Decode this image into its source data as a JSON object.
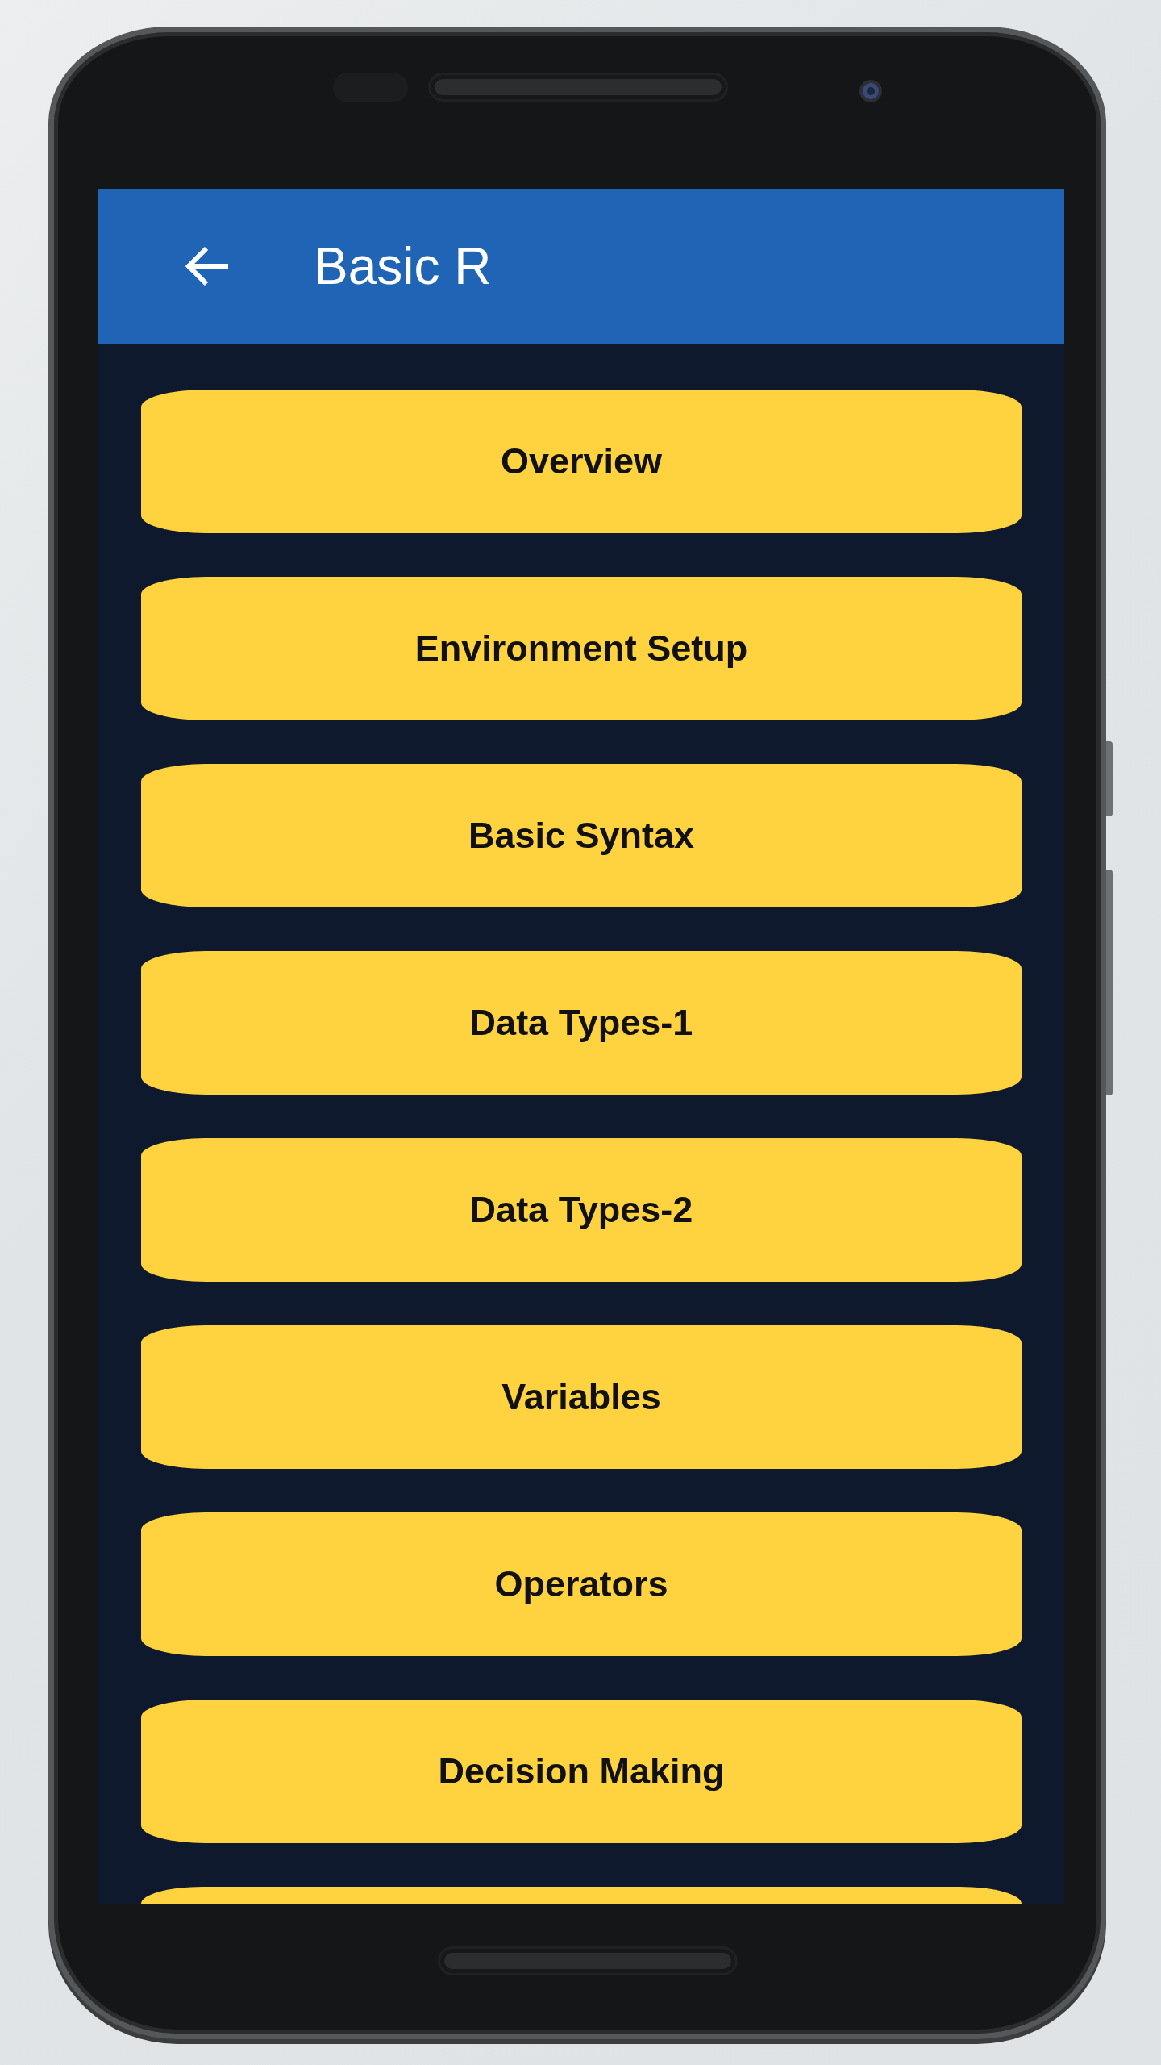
{
  "app_bar": {
    "title": "Basic R"
  },
  "topics": [
    {
      "label": "Overview"
    },
    {
      "label": "Environment Setup"
    },
    {
      "label": "Basic Syntax"
    },
    {
      "label": "Data Types-1"
    },
    {
      "label": "Data Types-2"
    },
    {
      "label": "Variables"
    },
    {
      "label": "Operators"
    },
    {
      "label": "Decision Making"
    }
  ],
  "more_topics_below": true
}
